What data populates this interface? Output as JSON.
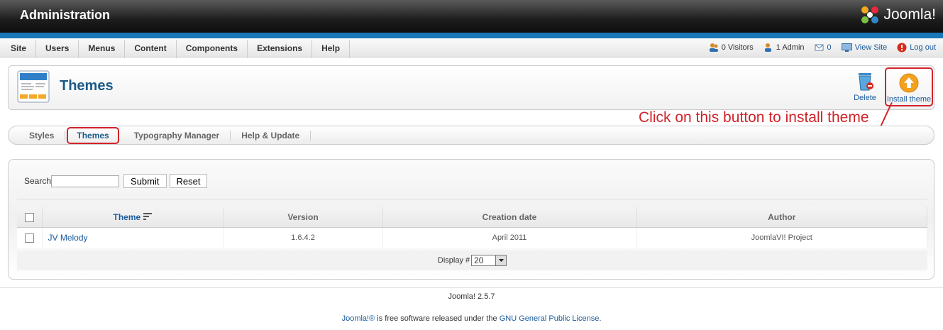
{
  "header": {
    "title": "Administration",
    "logo_text": "Joomla!"
  },
  "menu": [
    "Site",
    "Users",
    "Menus",
    "Content",
    "Components",
    "Extensions",
    "Help"
  ],
  "status": {
    "visitors": "0 Visitors",
    "admins": "1 Admin",
    "messages": "0",
    "view_site": "View Site",
    "logout": "Log out"
  },
  "toolbar": {
    "title": "Themes",
    "delete_label": "Delete",
    "install_label": "Install theme"
  },
  "annotation": "Click on this button to install theme",
  "submenu": [
    "Styles",
    "Themes",
    "Typography Manager",
    "Help & Update"
  ],
  "search": {
    "label": "Search",
    "submit_label": "Submit",
    "reset_label": "Reset"
  },
  "table": {
    "headers": [
      "Theme",
      "Version",
      "Creation date",
      "Author"
    ],
    "rows": [
      {
        "name": "JV Melody",
        "version": "1.6.4.2",
        "date": "April 2011",
        "author": "JoomlaVI! Project"
      }
    ]
  },
  "pager": {
    "label": "Display #",
    "value": "20"
  },
  "footer": {
    "version": "Joomla! 2.5.7",
    "brand": "Joomla!®",
    "license_text": " is free software released under the ",
    "license_link": "GNU General Public License",
    "period": "."
  },
  "colors": {
    "accent": "#1a77b8",
    "annotation": "#d0232a",
    "link": "#1a5b9c"
  }
}
